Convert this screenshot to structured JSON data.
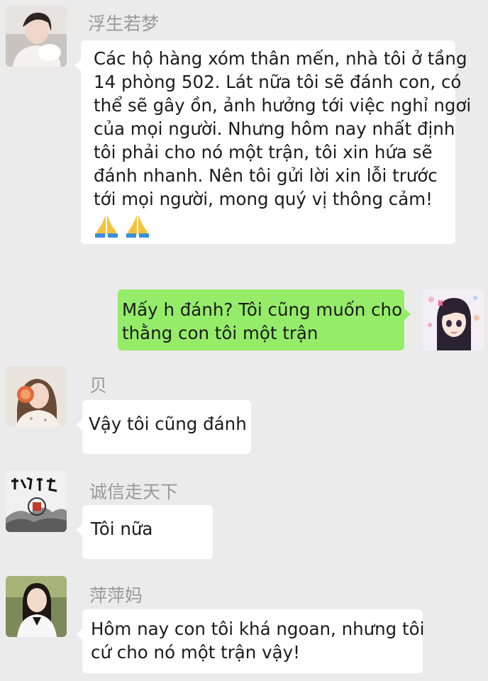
{
  "messages": [
    {
      "sender": "浮生若梦",
      "lines": [
        "Các hộ hàng xóm thân mến, nhà tôi ở tầng",
        "14 phòng 502. Lát nữa tôi sẽ đánh con, có",
        "thể sẽ gây ồn, ảnh hưởng tới việc nghỉ ngơi",
        "của mọi người. Nhưng hôm nay nhất định",
        "tôi phải cho nó một trận, tôi xin hứa sẽ",
        "đánh nhanh. Nên tôi gửi lời xin lỗi trước",
        "tới mọi người, mong quý vị thông cảm!"
      ],
      "emojis": [
        "folded-hands-emoji",
        "folded-hands-emoji"
      ]
    },
    {
      "sender": "",
      "lines": [
        "Mấy h đánh? Tôi cũng muốn cho",
        "thằng con tôi một trận"
      ]
    },
    {
      "sender": "贝",
      "lines": [
        "Vậy tôi cũng đánh"
      ]
    },
    {
      "sender": "诚信走天下",
      "lines": [
        "Tôi nữa"
      ]
    },
    {
      "sender": "萍萍妈",
      "lines": [
        "Hôm nay con tôi khá ngoan, nhưng tôi",
        "cứ cho nó một trận vậy!"
      ]
    }
  ],
  "colors": {
    "background": "#ebebeb",
    "bubble_incoming": "#ffffff",
    "bubble_outgoing": "#95ec69",
    "sender_name": "#9a9a9a"
  }
}
